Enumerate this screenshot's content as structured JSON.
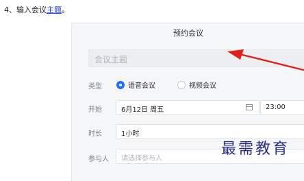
{
  "step": {
    "number": "4、",
    "text": "输入会议",
    "link": "主题",
    "end": "。"
  },
  "dialog": {
    "title": "预约会议",
    "subject_placeholder": "会议主题",
    "type": {
      "label": "类型",
      "options": [
        {
          "label": "语音会议",
          "selected": true
        },
        {
          "label": "视频会议",
          "selected": false
        }
      ]
    },
    "start": {
      "label": "开始",
      "date": "6月12日 周五",
      "time": "23:00"
    },
    "duration": {
      "label": "时长",
      "value": "1小时"
    },
    "participants": {
      "label": "参与人",
      "placeholder": "请选择参与人"
    }
  },
  "watermark": "最需教育",
  "colors": {
    "accent": "#1f6ff0",
    "arrow": "#e0201b",
    "link": "#1a3fd6",
    "watermark": "#2c2f86"
  }
}
